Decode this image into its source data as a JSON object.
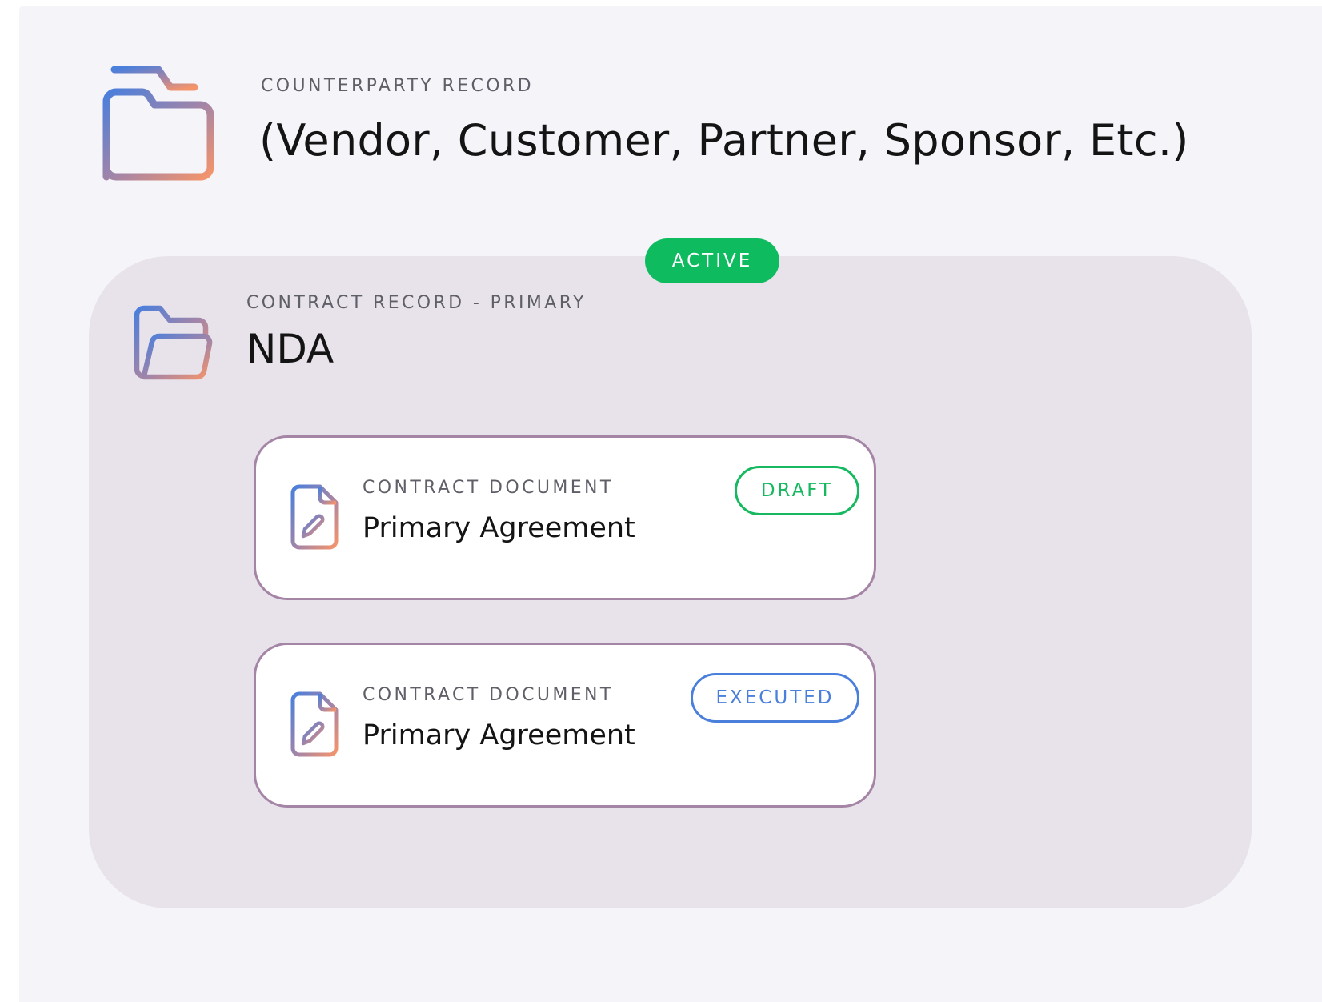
{
  "counterparty": {
    "eyebrow": "COUNTERPARTY RECORD",
    "title": "(Vendor, Customer, Partner, Sponsor, Etc.)",
    "icon": "folder-icon"
  },
  "contract_record": {
    "status": "ACTIVE",
    "eyebrow": "CONTRACT RECORD - PRIMARY",
    "title": "NDA",
    "icon": "folder-open-icon"
  },
  "documents": [
    {
      "eyebrow": "CONTRACT DOCUMENT",
      "title": "Primary Agreement",
      "status": "DRAFT",
      "icon": "document-signature-icon"
    },
    {
      "eyebrow": "CONTRACT DOCUMENT",
      "title": "Primary Agreement",
      "status": "EXECUTED",
      "icon": "document-signature-icon"
    }
  ],
  "colors": {
    "canvas_bg": "#f5f4f9",
    "panel_bg": "#e8e3eb",
    "active_green": "#0fbb5f",
    "draft_green": "#16b95f",
    "executed_blue": "#4a7fdc",
    "card_border": "#a585a6",
    "icon_gradient_start": "#4a7fdc",
    "icon_gradient_end": "#f5946a"
  }
}
